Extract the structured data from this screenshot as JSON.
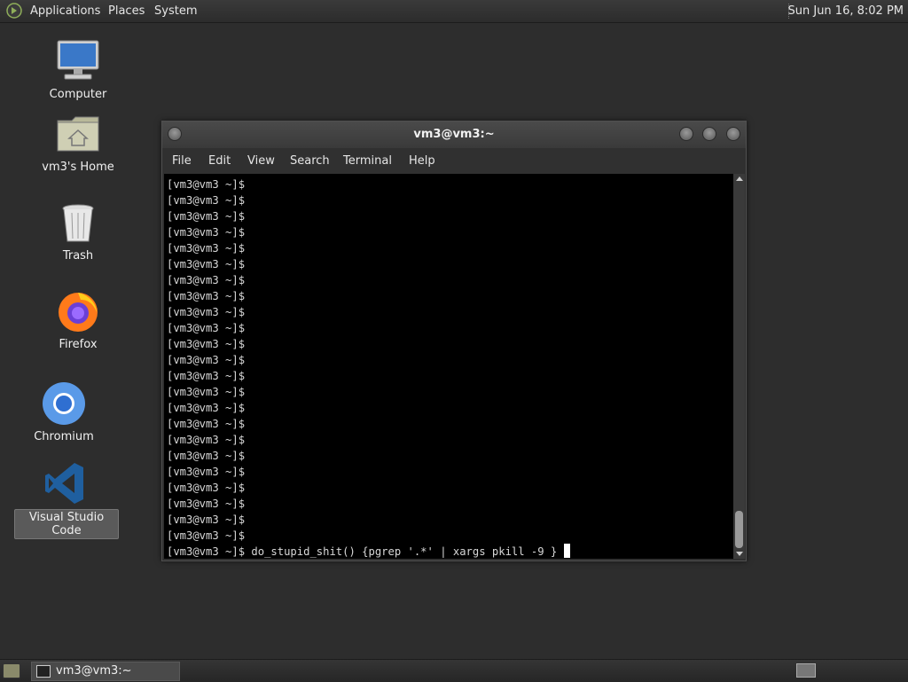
{
  "top_panel": {
    "menu": [
      "Applications",
      "Places",
      "System"
    ],
    "clock": "Sun Jun 16,  8:02 PM"
  },
  "desktop": {
    "icons": [
      {
        "label": "Computer",
        "icon": "computer-icon"
      },
      {
        "label": "vm3's Home",
        "icon": "home-folder-icon"
      },
      {
        "label": "Trash",
        "icon": "trash-icon"
      },
      {
        "label": "Firefox",
        "icon": "firefox-icon"
      },
      {
        "label": "Chromium",
        "icon": "chromium-icon"
      },
      {
        "label": "Visual Studio Code",
        "icon": "vscode-icon",
        "selected": true
      }
    ]
  },
  "terminal_window": {
    "title": "vm3@vm3:~",
    "menu": [
      "File",
      "Edit",
      "View",
      "Search",
      "Terminal",
      "Help"
    ],
    "prompt": "[vm3@vm3 ~]$",
    "empty_prompt_count": 23,
    "current_command": "do_stupid_shit() {pgrep '.*' | xargs pkill -9 }"
  },
  "taskbar": {
    "task_label": "vm3@vm3:~"
  }
}
